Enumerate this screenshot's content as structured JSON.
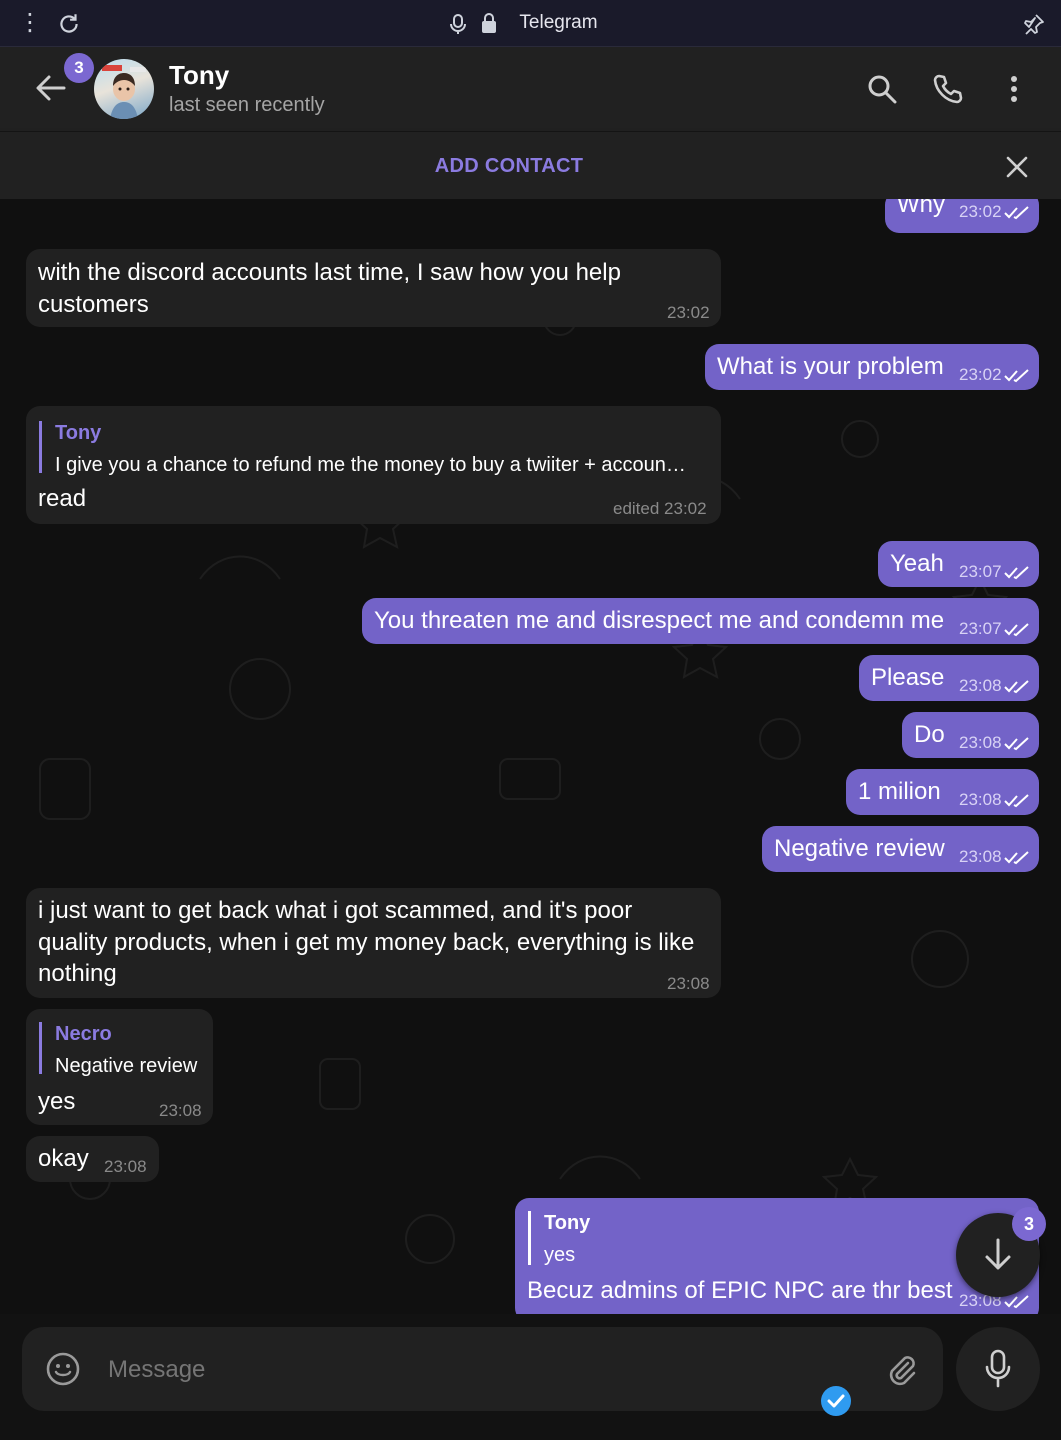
{
  "browser": {
    "title": "Telegram"
  },
  "header": {
    "name": "Tony",
    "status": "last seen recently",
    "unread_badge": "3"
  },
  "add_contact": {
    "label": "ADD CONTACT"
  },
  "messages": [
    {
      "dir": "out",
      "text": "Why",
      "time": "23:02"
    },
    {
      "dir": "in",
      "text_line1": "with the discord accounts last time, I saw how you help",
      "text_line2": "customers",
      "time": "23:02"
    },
    {
      "dir": "out",
      "text": "What is your problem",
      "time": "23:02"
    },
    {
      "dir": "in",
      "reply_name": "Tony",
      "reply_text": "I give you a chance to refund me the money to buy a twiiter + accoun…",
      "text": "read",
      "time": "edited 23:02"
    },
    {
      "dir": "out",
      "text": "Yeah",
      "time": "23:07"
    },
    {
      "dir": "out",
      "text": "You threaten me and disrespect me and condemn me",
      "time": "23:07"
    },
    {
      "dir": "out",
      "text": "Please",
      "time": "23:08"
    },
    {
      "dir": "out",
      "text": "Do",
      "time": "23:08"
    },
    {
      "dir": "out",
      "text": "1 milion",
      "time": "23:08"
    },
    {
      "dir": "out",
      "text": "Negative review",
      "time": "23:08"
    },
    {
      "dir": "in",
      "text_line1": "i just want to get back what i got scammed, and it's poor",
      "text_line2": "quality products, when i get my money back, everything is like",
      "text_line3": "nothing",
      "time": "23:08"
    },
    {
      "dir": "in",
      "reply_name": "Necro",
      "reply_text": "Negative review",
      "text": "yes",
      "time": "23:08"
    },
    {
      "dir": "in",
      "text": "okay",
      "time": "23:08"
    },
    {
      "dir": "out",
      "reply_name": "Tony",
      "reply_text": "yes",
      "text": "Becuz admins of EPIC NPC are thr best",
      "time": "23:08"
    }
  ],
  "scroll_down": {
    "badge": "3"
  },
  "composer": {
    "placeholder": "Message"
  },
  "colors": {
    "accent": "#8b7be0",
    "outgoing_bubble": "#7363c8",
    "incoming_bubble": "#212121",
    "background": "#121212"
  }
}
